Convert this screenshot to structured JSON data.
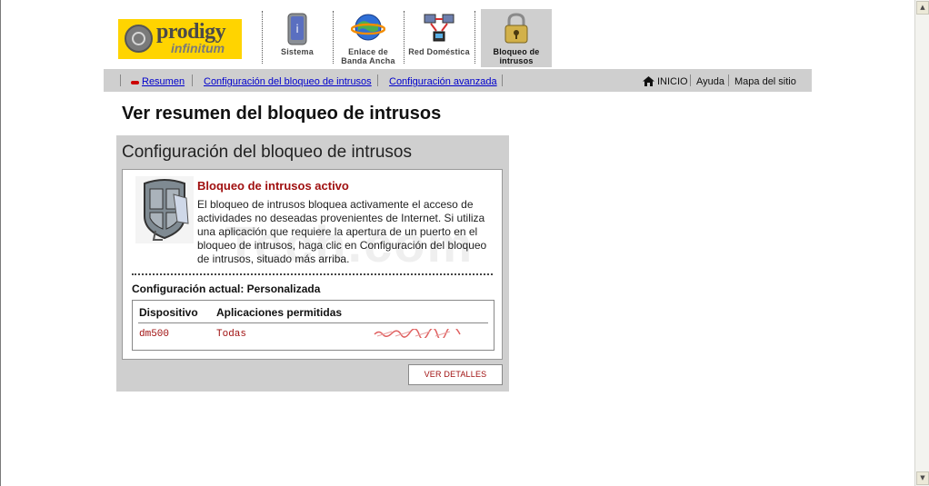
{
  "logo": {
    "line1": "prodigy",
    "line2": "infinitum"
  },
  "nav": {
    "tabs": [
      {
        "label": "Sistema",
        "icon": "system-icon",
        "active": false
      },
      {
        "label": "Enlace de Banda Ancha",
        "icon": "globe-icon",
        "active": false
      },
      {
        "label": "Red Doméstica",
        "icon": "network-icon",
        "active": false
      },
      {
        "label": "Bloqueo de intrusos",
        "icon": "padlock-icon",
        "active": true
      }
    ]
  },
  "subnav": {
    "links": [
      "Resumen",
      "Configuración del bloqueo de intrusos",
      "Configuración avanzada"
    ],
    "right": {
      "home": "INICIO",
      "help": "Ayuda",
      "sitemap": "Mapa del sitio"
    }
  },
  "page": {
    "title": "Ver resumen del bloqueo de intrusos"
  },
  "panel": {
    "title": "Configuración del bloqueo de intrusos",
    "status_title": "Bloqueo de intrusos activo",
    "description": "El bloqueo de intrusos bloquea activamente el acceso de actividades no deseadas provenientes de Internet. Si utiliza una aplicación que requiere la apertura de un puerto en el bloqueo de intrusos, haga clic en Configuración del bloqueo de intrusos, situado más arriba.",
    "current_config": "Configuración actual: Personalizada",
    "table": {
      "headers": [
        "Dispositivo",
        "Aplicaciones permitidas"
      ],
      "rows": [
        {
          "device": "dm500",
          "apps": "Todas"
        }
      ]
    },
    "details_button": "VER DETALLES"
  },
  "colors": {
    "accent_red": "#a01010",
    "nav_grey": "#cfcfcf",
    "link_blue": "#0000cc",
    "logo_yellow": "#ffd400"
  }
}
